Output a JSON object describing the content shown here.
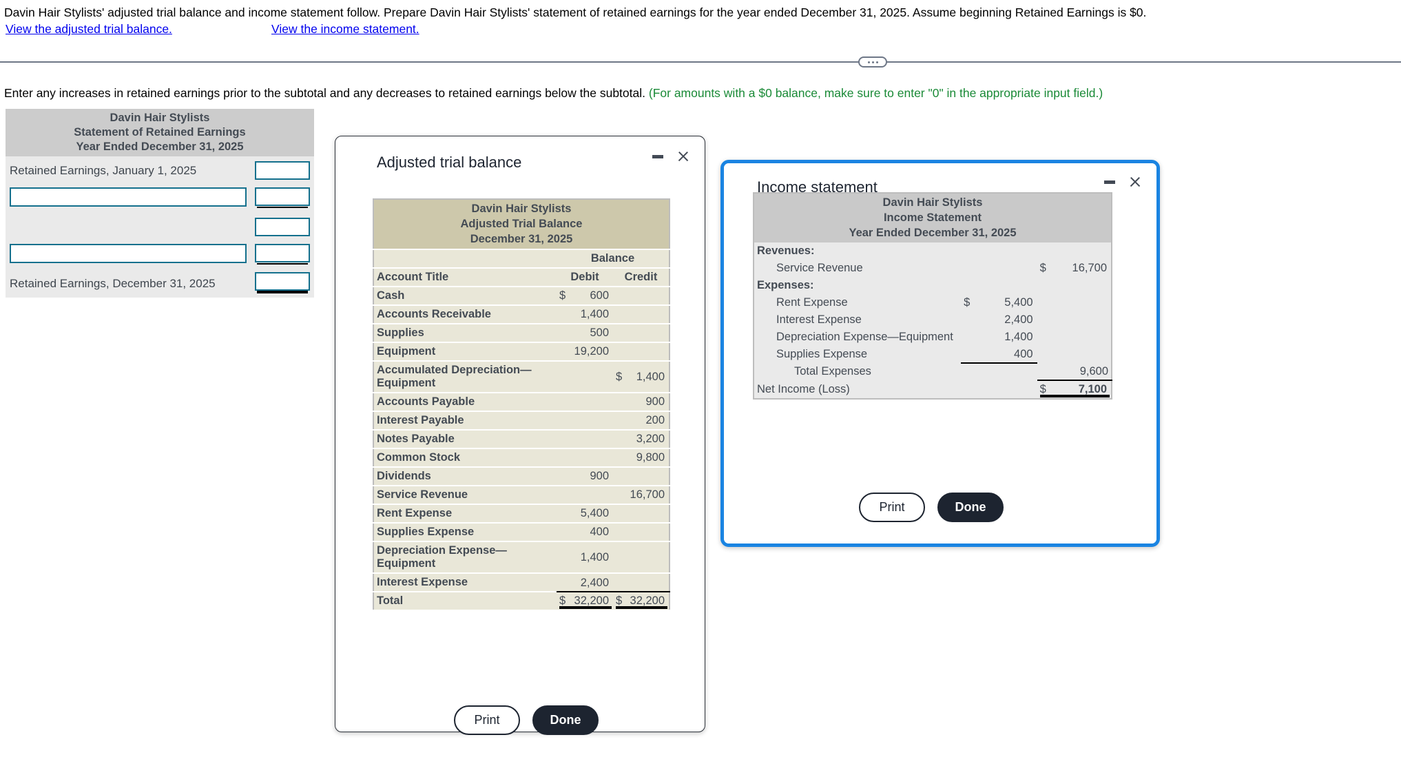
{
  "problem": {
    "statement": "Davin Hair Stylists' adjusted trial balance and income statement follow. Prepare Davin Hair Stylists' statement of retained earnings for the year ended December 31, 2025. Assume beginning Retained Earnings is $0.",
    "link_trial_balance": "View the adjusted trial balance.",
    "link_income_statement": "View the income statement.",
    "instruction_main": "Enter any increases in retained earnings prior to the subtotal and any decreases to retained earnings below the subtotal.",
    "instruction_note": "(For amounts with a $0 balance, make sure to enter \"0\" in the appropriate input field.)"
  },
  "worksheet": {
    "title_line1": "Davin Hair Stylists",
    "title_line2": "Statement of Retained Earnings",
    "title_line3": "Year Ended December 31, 2025",
    "rows": [
      {
        "label": "Retained Earnings, January 1, 2025",
        "has_text_input": false,
        "amount_value": "",
        "rule": "none"
      },
      {
        "label": "",
        "has_text_input": true,
        "text_value": "",
        "amount_value": "",
        "rule": "single"
      },
      {
        "label": "",
        "has_text_input": false,
        "amount_value": "",
        "rule": "none"
      },
      {
        "label": "",
        "has_text_input": true,
        "text_value": "",
        "amount_value": "",
        "rule": "single"
      },
      {
        "label": "Retained Earnings, December 31, 2025",
        "has_text_input": false,
        "amount_value": "",
        "rule": "double"
      }
    ]
  },
  "modal_trial_balance": {
    "window_title": "Adjusted trial balance",
    "minimize_icon": "minimize-icon",
    "close_icon": "close-icon",
    "report": {
      "title_line1": "Davin Hair Stylists",
      "title_line2": "Adjusted Trial Balance",
      "title_line3": "December 31, 2025",
      "group_header": "Balance",
      "col_account": "Account Title",
      "col_debit": "Debit",
      "col_credit": "Credit",
      "rows": [
        {
          "account": "Cash",
          "debit_symbol": "$",
          "debit": "600",
          "credit_symbol": "",
          "credit": ""
        },
        {
          "account": "Accounts Receivable",
          "debit_symbol": "",
          "debit": "1,400",
          "credit_symbol": "",
          "credit": ""
        },
        {
          "account": "Supplies",
          "debit_symbol": "",
          "debit": "500",
          "credit_symbol": "",
          "credit": ""
        },
        {
          "account": "Equipment",
          "debit_symbol": "",
          "debit": "19,200",
          "credit_symbol": "",
          "credit": ""
        },
        {
          "account": "Accumulated Depreciation—Equipment",
          "debit_symbol": "",
          "debit": "",
          "credit_symbol": "$",
          "credit": "1,400"
        },
        {
          "account": "Accounts Payable",
          "debit_symbol": "",
          "debit": "",
          "credit_symbol": "",
          "credit": "900"
        },
        {
          "account": "Interest Payable",
          "debit_symbol": "",
          "debit": "",
          "credit_symbol": "",
          "credit": "200"
        },
        {
          "account": "Notes Payable",
          "debit_symbol": "",
          "debit": "",
          "credit_symbol": "",
          "credit": "3,200"
        },
        {
          "account": "Common Stock",
          "debit_symbol": "",
          "debit": "",
          "credit_symbol": "",
          "credit": "9,800"
        },
        {
          "account": "Dividends",
          "debit_symbol": "",
          "debit": "900",
          "credit_symbol": "",
          "credit": ""
        },
        {
          "account": "Service Revenue",
          "debit_symbol": "",
          "debit": "",
          "credit_symbol": "",
          "credit": "16,700"
        },
        {
          "account": "Rent Expense",
          "debit_symbol": "",
          "debit": "5,400",
          "credit_symbol": "",
          "credit": ""
        },
        {
          "account": "Supplies Expense",
          "debit_symbol": "",
          "debit": "400",
          "credit_symbol": "",
          "credit": ""
        },
        {
          "account": "Depreciation Expense—Equipment",
          "debit_symbol": "",
          "debit": "1,400",
          "credit_symbol": "",
          "credit": ""
        },
        {
          "account": "Interest Expense",
          "debit_symbol": "",
          "debit": "2,400",
          "credit_symbol": "",
          "credit": ""
        }
      ],
      "total_label": "Total",
      "total_debit_symbol": "$",
      "total_debit": "32,200",
      "total_credit_symbol": "$",
      "total_credit": "32,200"
    },
    "print_label": "Print",
    "done_label": "Done"
  },
  "modal_income_statement": {
    "window_title": "Income statement",
    "minimize_icon": "minimize-icon",
    "close_icon": "close-icon",
    "report": {
      "title_line1": "Davin Hair Stylists",
      "title_line2": "Income Statement",
      "title_line3": "Year Ended December 31, 2025",
      "revenues_header": "Revenues:",
      "revenue_line_label": "Service Revenue",
      "revenue_symbol": "$",
      "revenue_amount": "16,700",
      "expenses_header": "Expenses:",
      "expenses": [
        {
          "label": "Rent Expense",
          "symbol": "$",
          "amount": "5,400"
        },
        {
          "label": "Interest Expense",
          "symbol": "",
          "amount": "2,400"
        },
        {
          "label": "Depreciation Expense—Equipment",
          "symbol": "",
          "amount": "1,400"
        },
        {
          "label": "Supplies Expense",
          "symbol": "",
          "amount": "400"
        }
      ],
      "total_expenses_label": "Total Expenses",
      "total_expenses_amount": "9,600",
      "net_income_label": "Net Income (Loss)",
      "net_income_symbol": "$",
      "net_income_amount": "7,100"
    },
    "print_label": "Print",
    "done_label": "Done"
  },
  "colors": {
    "link": "#0000ee",
    "note_green": "#1a8a37",
    "input_border": "#14708d",
    "focus_border": "#1a84e2",
    "tb_header_bg": "#cdc8ab",
    "is_header_bg": "#c9c9c9"
  }
}
